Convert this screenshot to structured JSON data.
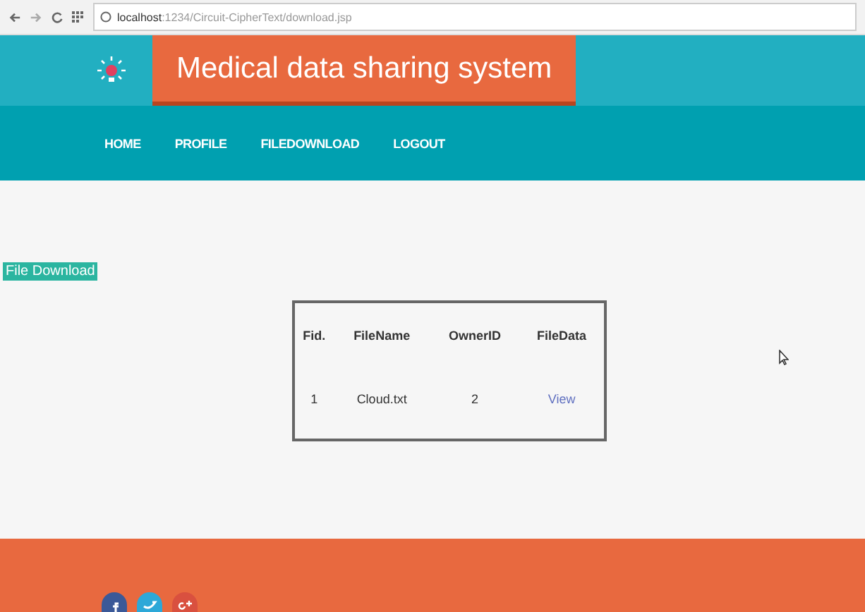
{
  "browser": {
    "url_host": "localhost",
    "url_path": ":1234/Circuit-CipherText/download.jsp"
  },
  "header": {
    "title": "Medical data sharing system"
  },
  "nav": [
    {
      "label": "HOME"
    },
    {
      "label": "PROFILE"
    },
    {
      "label": "FILEDOWNLOAD"
    },
    {
      "label": "LOGOUT"
    }
  ],
  "section_label": "File Download",
  "table": {
    "columns": [
      "Fid.",
      "FileName",
      "OwnerID",
      "FileData"
    ],
    "rows": [
      {
        "cells": [
          "1",
          "Cloud.txt",
          "2"
        ],
        "link": "View"
      }
    ]
  }
}
